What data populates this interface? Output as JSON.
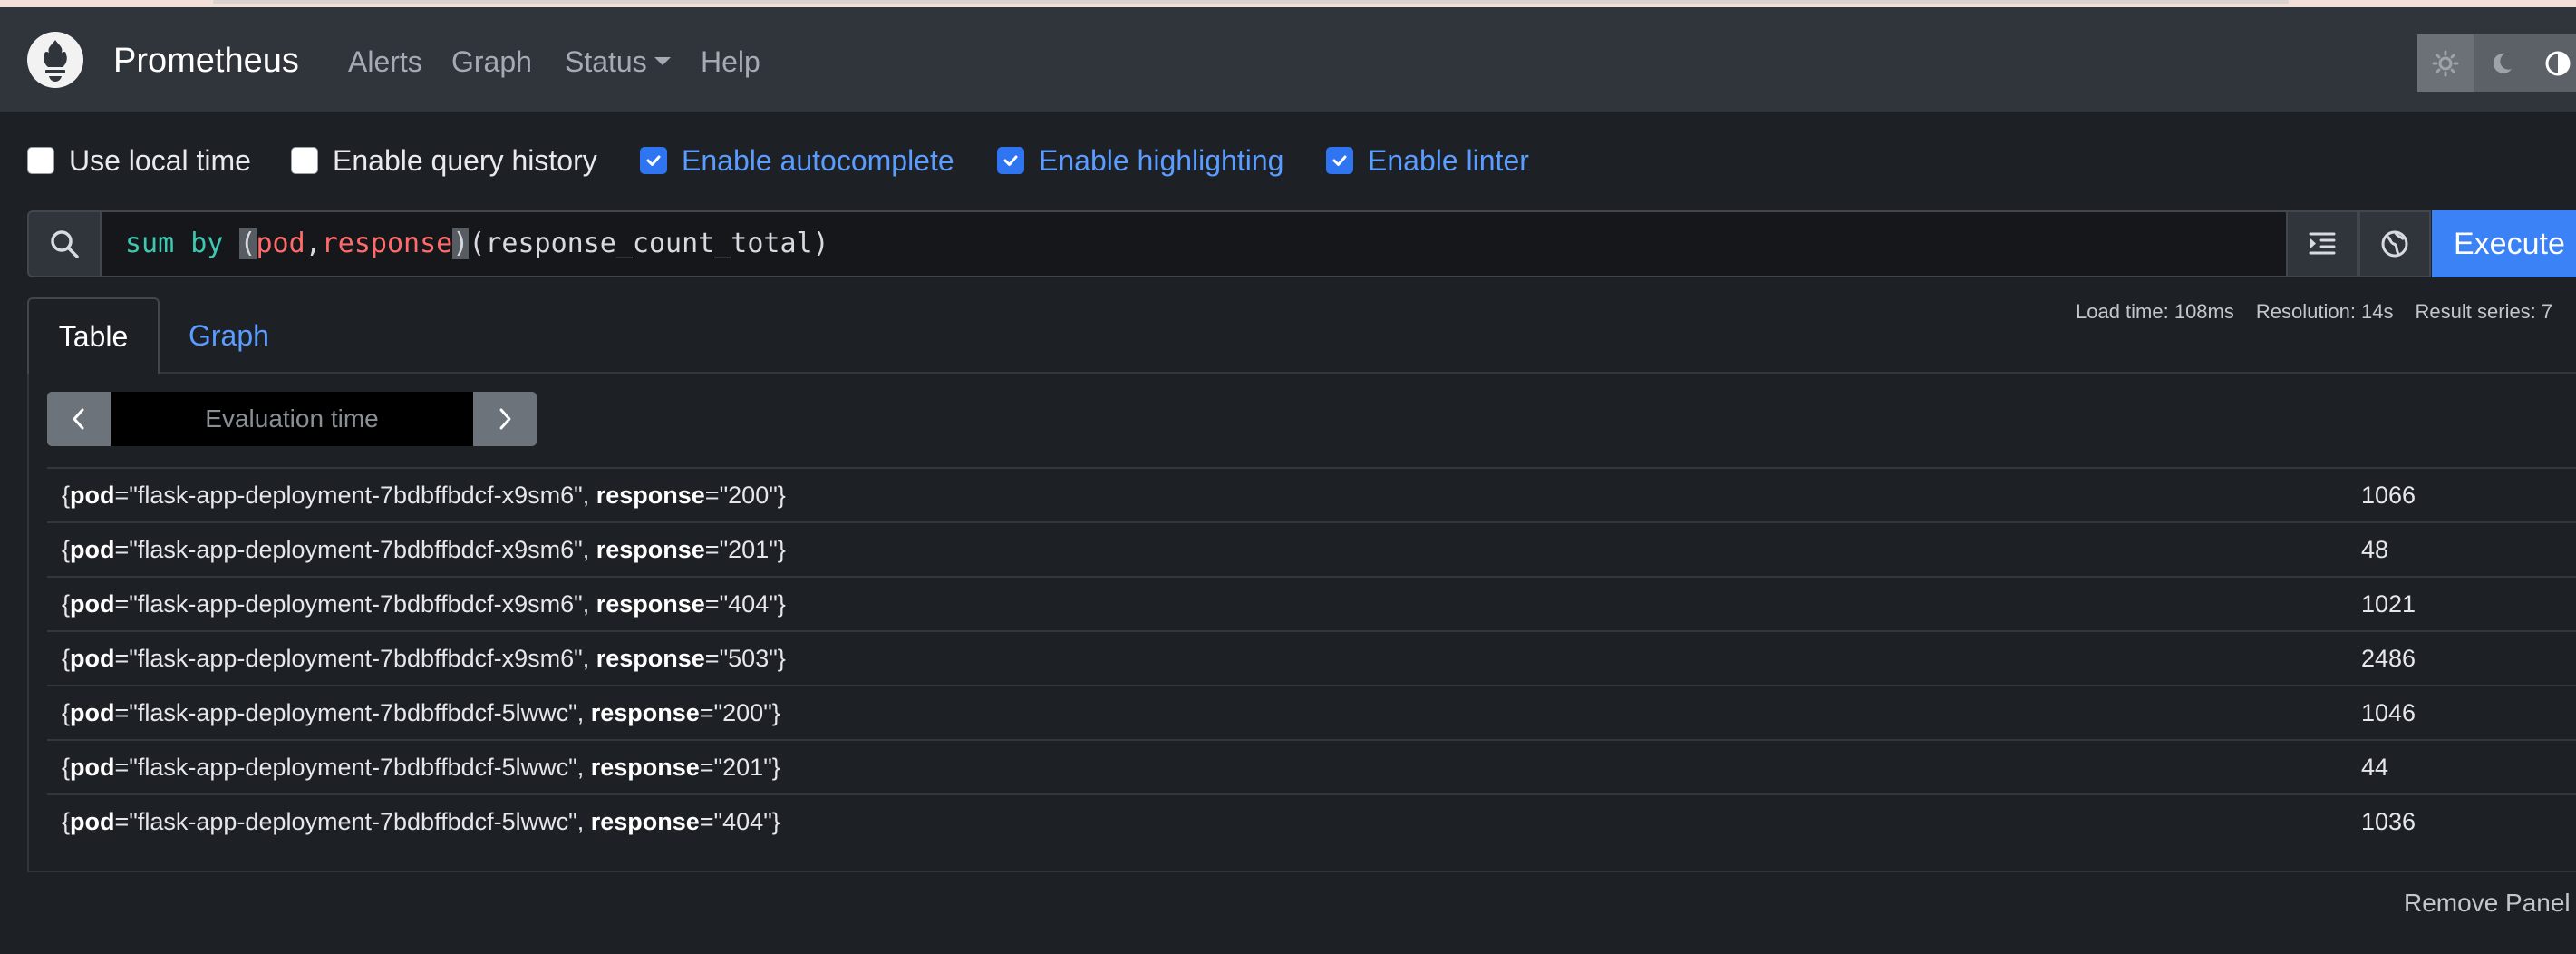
{
  "navbar": {
    "brand": "Prometheus",
    "links": [
      "Alerts",
      "Graph",
      "Status",
      "Help"
    ],
    "theme_icons": [
      "sun-icon",
      "moon-icon",
      "contrast-icon"
    ]
  },
  "options": [
    {
      "label": "Use local time",
      "checked": false
    },
    {
      "label": "Enable query history",
      "checked": false
    },
    {
      "label": "Enable autocomplete",
      "checked": true
    },
    {
      "label": "Enable highlighting",
      "checked": true
    },
    {
      "label": "Enable linter",
      "checked": true
    }
  ],
  "query": {
    "kw": "sum by ",
    "open": "(",
    "l1": "pod",
    "comma": ",",
    "l2": "response",
    "close": ")",
    "rest": "(response_count_total)"
  },
  "execute_label": "Execute",
  "stats": {
    "load_time": "Load time: 108ms",
    "resolution": "Resolution: 14s",
    "result_series": "Result series: 7"
  },
  "tabs": {
    "table": "Table",
    "graph": "Graph"
  },
  "eval_placeholder": "Evaluation time",
  "results": [
    {
      "pod": "flask-app-deployment-7bdbffbdcf-x9sm6",
      "response": "200",
      "value": "1066"
    },
    {
      "pod": "flask-app-deployment-7bdbffbdcf-x9sm6",
      "response": "201",
      "value": "48"
    },
    {
      "pod": "flask-app-deployment-7bdbffbdcf-x9sm6",
      "response": "404",
      "value": "1021"
    },
    {
      "pod": "flask-app-deployment-7bdbffbdcf-x9sm6",
      "response": "503",
      "value": "2486"
    },
    {
      "pod": "flask-app-deployment-7bdbffbdcf-5lwwc",
      "response": "200",
      "value": "1046"
    },
    {
      "pod": "flask-app-deployment-7bdbffbdcf-5lwwc",
      "response": "201",
      "value": "44"
    },
    {
      "pod": "flask-app-deployment-7bdbffbdcf-5lwwc",
      "response": "404",
      "value": "1036"
    }
  ],
  "remove_panel": "Remove Panel",
  "colors": {
    "accent": "#3a82f6",
    "navbar": "#30343b",
    "background": "#1d2025"
  }
}
